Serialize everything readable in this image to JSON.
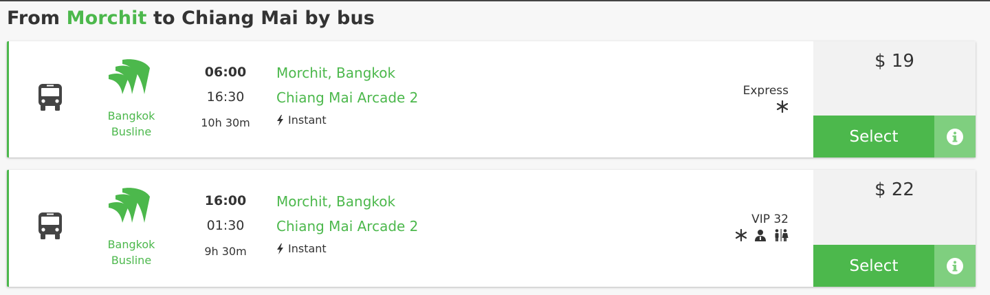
{
  "title": {
    "prefix": "From",
    "origin": "Morchit",
    "suffix": "to Chiang Mai by bus"
  },
  "colors": {
    "accent": "#4cb84c",
    "accent_light": "#7fcf7f",
    "text": "#333333",
    "panel": "#f2f2f2"
  },
  "trips": [
    {
      "operator": {
        "line1": "Bangkok",
        "line2": "Busline",
        "logo_icon": "bangkok-busline-logo"
      },
      "departure": "06:00",
      "arrival": "16:30",
      "duration": "10h 30m",
      "from_station": "Morchit, Bangkok",
      "to_station": "Chiang Mai Arcade 2",
      "booking": "Instant",
      "class": "Express",
      "amenities": [
        "snowflake-icon"
      ],
      "price": "$ 19",
      "select_label": "Select"
    },
    {
      "operator": {
        "line1": "Bangkok",
        "line2": "Busline",
        "logo_icon": "bangkok-busline-logo"
      },
      "departure": "16:00",
      "arrival": "01:30",
      "duration": "9h 30m",
      "from_station": "Morchit, Bangkok",
      "to_station": "Chiang Mai Arcade 2",
      "booking": "Instant",
      "class": "VIP 32",
      "amenities": [
        "snowflake-icon",
        "attendant-icon",
        "restroom-icon"
      ],
      "price": "$ 22",
      "select_label": "Select"
    }
  ]
}
